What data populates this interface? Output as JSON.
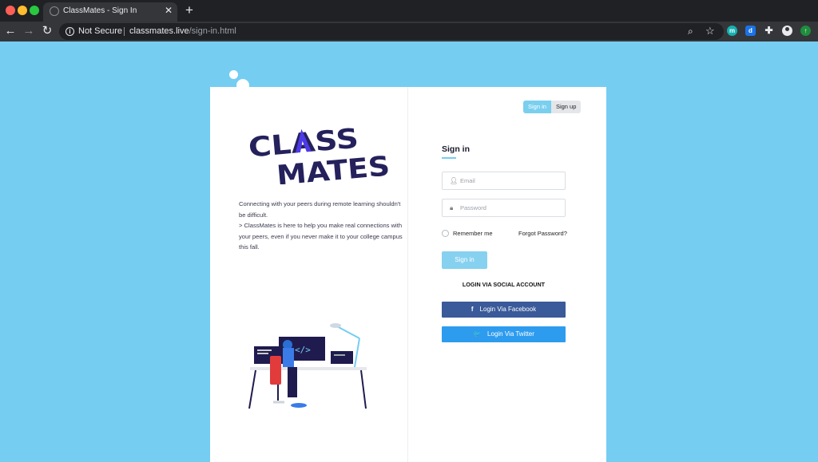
{
  "browser": {
    "tab_title": "ClassMates - Sign In",
    "security_label": "Not Secure",
    "url_host": "classmates.live",
    "url_path": "/sign-in.html",
    "extensions": [
      "m",
      "d"
    ]
  },
  "brand": {
    "logo_line1": "CLASS",
    "logo_line2": "MATES",
    "colors": {
      "logo": "#25215c",
      "accent": "#4e3ae8",
      "page_bg": "#75cdf2",
      "facebook": "#3a5a99",
      "twitter": "#2d9cef"
    }
  },
  "intro": {
    "line1": "Connecting with your peers during remote learning shouldn't be difficult.",
    "line2": "> ClassMates is here to help you make real connections with your peers, even if you never make it to your college campus this fall."
  },
  "tabs": {
    "signin": "Sign in",
    "signup": "Sign up",
    "active": "signin"
  },
  "form": {
    "title": "Sign in",
    "email_placeholder": "Email",
    "password_placeholder": "Password",
    "remember_label": "Remember me",
    "forgot_label": "Forgot Password?",
    "submit_label": "Sign in",
    "social_label": "LOGIN VIA SOCIAL ACCOUNT",
    "facebook_label": "Login Via Facebook",
    "twitter_label": "Login Via Twitter"
  },
  "icons": {
    "facebook": "f",
    "twitter": "🐦"
  }
}
